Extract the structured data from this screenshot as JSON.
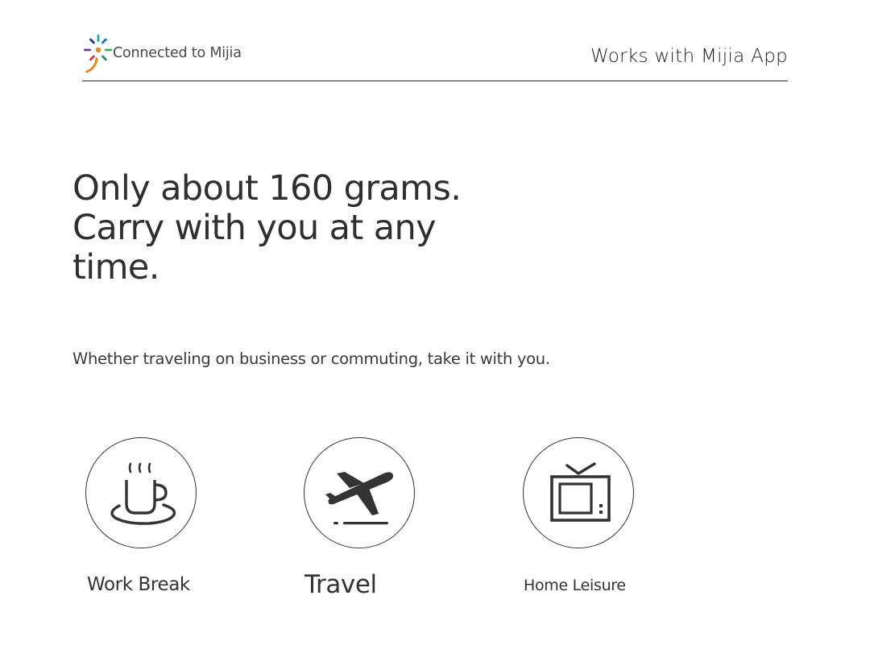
{
  "header": {
    "brand_text": "Connected to Mijia",
    "works_with": "Works with Mijia App",
    "brand_icon": "mijia-logo-icon"
  },
  "headline": {
    "line1": "Only about 160 grams.",
    "line2": "Carry with you at any",
    "line3": "time."
  },
  "subtext": "Whether traveling on business or commuting, take it with you.",
  "scenes": [
    {
      "label": "Work Break",
      "icon": "coffee-cup-icon"
    },
    {
      "label": "Travel",
      "icon": "airplane-icon"
    },
    {
      "label": "Home Leisure",
      "icon": "television-icon"
    }
  ],
  "colors": {
    "text": "#333333",
    "line": "#2a2a2a",
    "logo_blue": "#1a6fc4",
    "logo_green": "#3aaa5c",
    "logo_orange": "#e08a1e",
    "logo_red": "#d0343c",
    "logo_purple": "#6c3fa0",
    "logo_teal": "#1fa7a7"
  }
}
